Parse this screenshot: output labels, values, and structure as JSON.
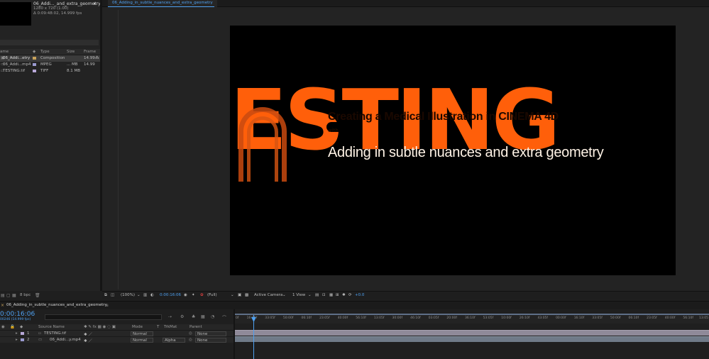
{
  "project": {
    "comp_name": "06_Addi..._and_extra_geometry",
    "dropdown_glyph": "▾",
    "dimensions": "1280 x 720 (1.00)",
    "duration": "Δ 0:09:48:02, 14.999 fps",
    "columns": {
      "name": "ame",
      "type": "Type",
      "size": "Size",
      "frame": "Frame ..."
    },
    "items": [
      {
        "name": "06_Addi...etry",
        "type": "Composition",
        "size": "",
        "frame": "14.99",
        "color": "#c8a25a",
        "icon": "composition-icon"
      },
      {
        "name": "06_Addi...mp4",
        "type": "MPEG",
        "size": "... MB",
        "frame": "14.99",
        "color": "#9a9ad0",
        "icon": "video-file-icon"
      },
      {
        "name": "TESTING.tif",
        "type": "TIFF",
        "size": "8.1 MB",
        "frame": "",
        "color": "#b8a8d8",
        "icon": "image-file-icon"
      }
    ],
    "bpc": "8 bpc"
  },
  "viewer": {
    "tab_label": "06_Adding_in_subtle_nuances_and_extra_geometry",
    "big_text": "ESTING",
    "overlay_title": "Creating a Medical Illustration in CINEMA 4D",
    "overlay_with": "with",
    "overlay_sub": "Adding in subtle nuances and extra geometry",
    "text_color": "#ff5f0a",
    "toolbar": {
      "zoom": "(100%)",
      "timecode": "0:00:16:06",
      "resolution": "(Full)",
      "camera": "Active Camera",
      "views": "1 View",
      "exposure": "+0.0"
    }
  },
  "timeline": {
    "tab_label": "06_Adding_in_subtle_nuances_and_extra_geometry",
    "timecode": "0:00:16:06",
    "fps": "00246 (14.999 fps)",
    "col_source": "Source Name",
    "col_mode": "Mode",
    "col_t": "T",
    "col_trkmat": "TrkMat",
    "col_parent": "Parent",
    "layers": [
      {
        "num": "1",
        "name": "TESTING.tif",
        "mode": "Normal",
        "trkmat": "",
        "parent": "None"
      },
      {
        "num": "2",
        "name": "06_Addi...y.mp4",
        "mode": "Normal",
        "trkmat": "Alpha",
        "parent": "None"
      }
    ],
    "ruler_ticks": [
      "0f",
      "16:05f",
      "33:05f",
      "50:00f",
      "06:10f",
      "23:05f",
      "40:00f",
      "56:10f",
      "13:05f",
      "30:00f",
      "46:10f",
      "03:05f",
      "20:00f",
      "36:10f",
      "53:05f",
      "10:00f",
      "26:10f",
      "43:05f",
      "00:00f",
      "16:10f",
      "33:05f",
      "50:00f",
      "06:10f",
      "23:05f",
      "40:00f",
      "56:10f",
      "13:05"
    ],
    "playhead_color": "#4ea0f0"
  }
}
